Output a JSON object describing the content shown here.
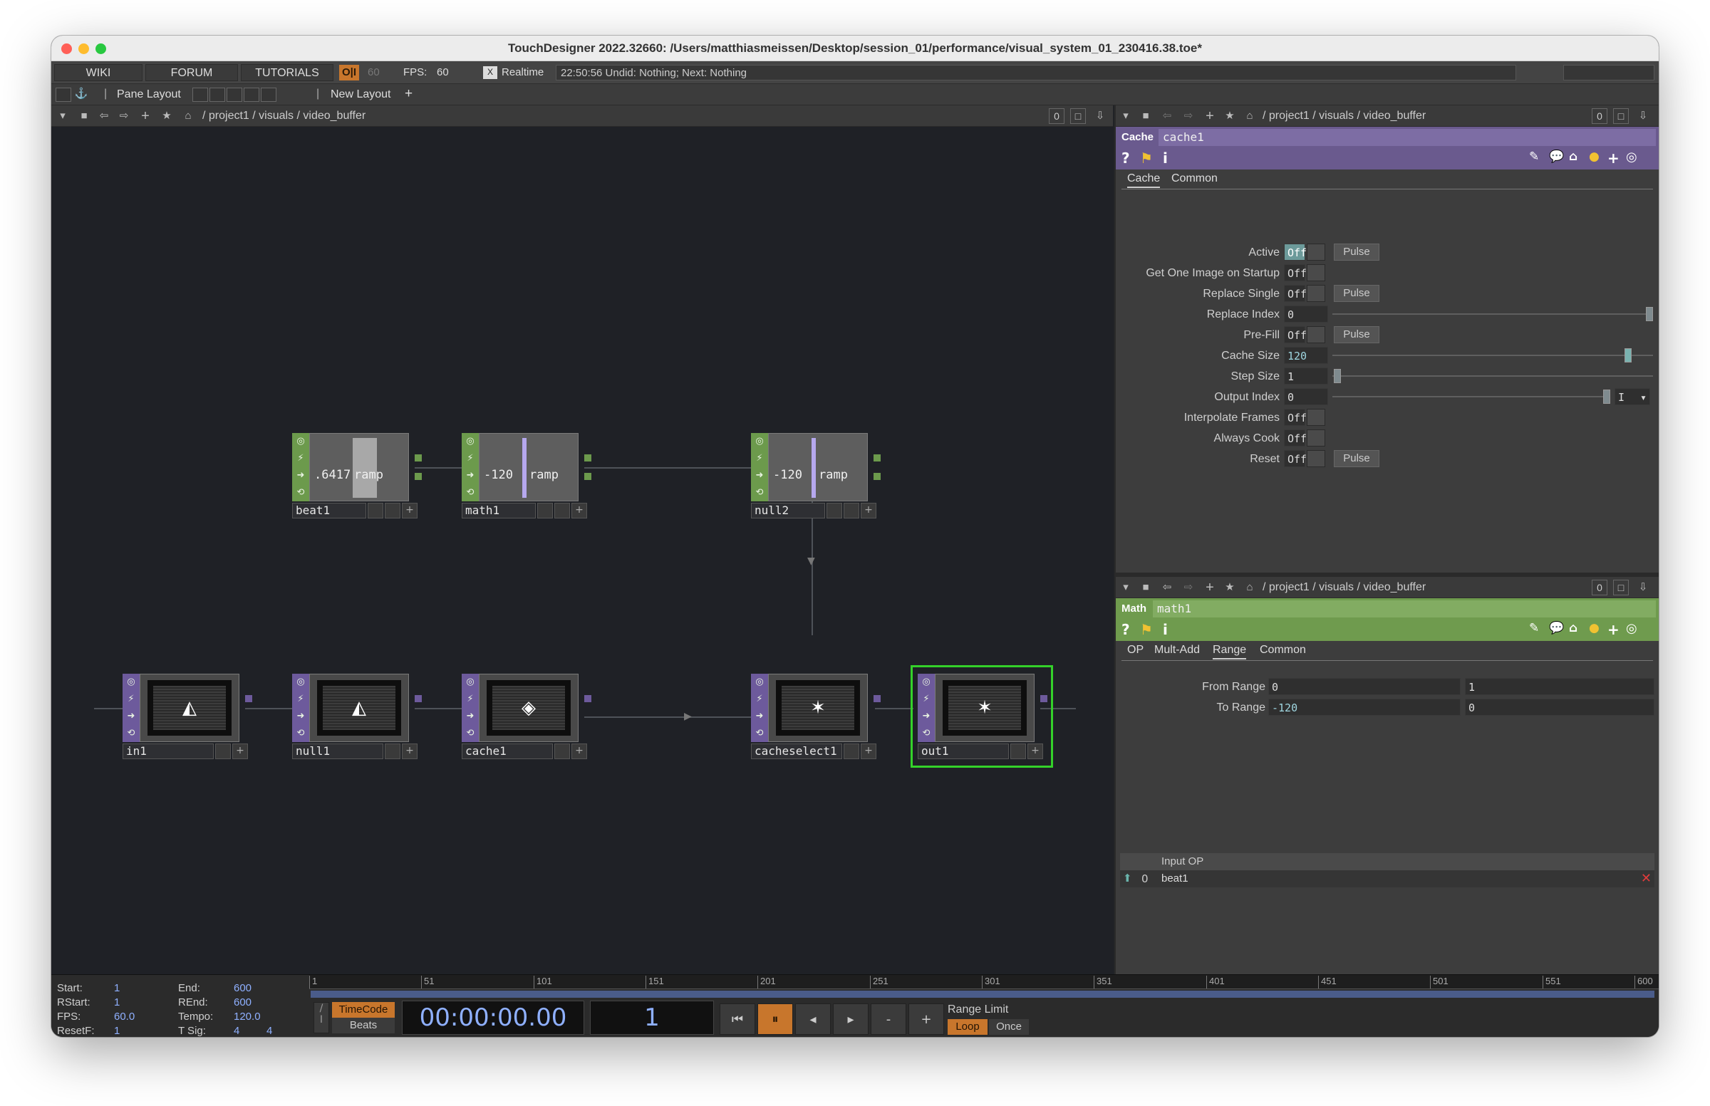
{
  "window": {
    "title": "TouchDesigner 2022.32660: /Users/matthiasmeissen/Desktop/session_01/performance/visual_system_01_230416.38.toe*"
  },
  "menubar": {
    "wiki": "WIKI",
    "forum": "FORUM",
    "tutorials": "TUTORIALS",
    "oi": "O|I",
    "fps_cap": "60",
    "fps_label": "FPS:",
    "fps_value": "60",
    "realtime_check": "X",
    "realtime_label": "Realtime",
    "status": "22:50:56 Undid: Nothing; Next: Nothing"
  },
  "layoutbar": {
    "pane_layout": "Pane Layout",
    "new_layout": "New Layout",
    "plus": "+"
  },
  "network": {
    "path": "/ project1 / visuals / video_buffer",
    "zero": "0",
    "nodes": {
      "beat1": {
        "name": "beat1",
        "value": ".6417",
        "kind": "ramp"
      },
      "math1": {
        "name": "math1",
        "value": "-120",
        "kind": "ramp"
      },
      "null2": {
        "name": "null2",
        "value": "-120",
        "kind": "ramp"
      },
      "in1": {
        "name": "in1"
      },
      "null1": {
        "name": "null1"
      },
      "cache1": {
        "name": "cache1"
      },
      "cacheselect1": {
        "name": "cacheselect1"
      },
      "out1": {
        "name": "out1"
      }
    }
  },
  "panel_cache": {
    "path": "/ project1 / visuals / video_buffer",
    "zero": "0",
    "op_type": "Cache",
    "op_name": "cache1",
    "tabs": [
      "Cache",
      "Common"
    ],
    "params": [
      {
        "label": "Active",
        "value": "Off",
        "pulse": "Pulse"
      },
      {
        "label": "Get One Image on Startup",
        "value": "Off"
      },
      {
        "label": "Replace Single",
        "value": "Off",
        "pulse": "Pulse"
      },
      {
        "label": "Replace Index",
        "value": "0"
      },
      {
        "label": "Pre-Fill",
        "value": "Off",
        "pulse": "Pulse"
      },
      {
        "label": "Cache Size",
        "value": "120"
      },
      {
        "label": "Step Size",
        "value": "1"
      },
      {
        "label": "Output Index",
        "value": "0",
        "menu": "I"
      },
      {
        "label": "Interpolate Frames",
        "value": "Off"
      },
      {
        "label": "Always Cook",
        "value": "Off"
      },
      {
        "label": "Reset",
        "value": "Off",
        "pulse": "Pulse"
      }
    ]
  },
  "panel_math": {
    "path": "/ project1 / visuals / video_buffer",
    "zero": "0",
    "op_type": "Math",
    "op_name": "math1",
    "tabs": [
      "OP",
      "Mult-Add",
      "Range",
      "Common"
    ],
    "from_range": {
      "label": "From Range",
      "a": "0",
      "b": "1"
    },
    "to_range": {
      "label": "To Range",
      "a": "-120",
      "b": "0"
    },
    "input_header": "Input OP",
    "input_index": "0",
    "input_name": "beat1"
  },
  "timeline": {
    "start_label": "Start:",
    "start": "1",
    "end_label": "End:",
    "end": "600",
    "rstart_label": "RStart:",
    "rstart": "1",
    "rend_label": "REnd:",
    "rend": "600",
    "fps_label": "FPS:",
    "fps": "60.0",
    "tempo_label": "Tempo:",
    "tempo": "120.0",
    "resetf_label": "ResetF:",
    "resetf": "1",
    "tsig_label": "T Sig:",
    "tsig_a": "4",
    "tsig_b": "4",
    "ticks": [
      "1",
      "51",
      "101",
      "151",
      "201",
      "251",
      "301",
      "351",
      "401",
      "451",
      "501",
      "551",
      "600"
    ],
    "timecode_label": "TimeCode",
    "beats_label": "Beats",
    "timecode": "00:00:00.00",
    "frame": "1",
    "range_limit": "Range Limit",
    "loop": "Loop",
    "once": "Once"
  },
  "colors": {
    "chop": "#6c9a4c",
    "top": "#6d5a9c",
    "cache_header": "#6a5a8e",
    "math_header": "#6f9b4e",
    "selected": "#34d12a",
    "accent": "#c8762c"
  }
}
